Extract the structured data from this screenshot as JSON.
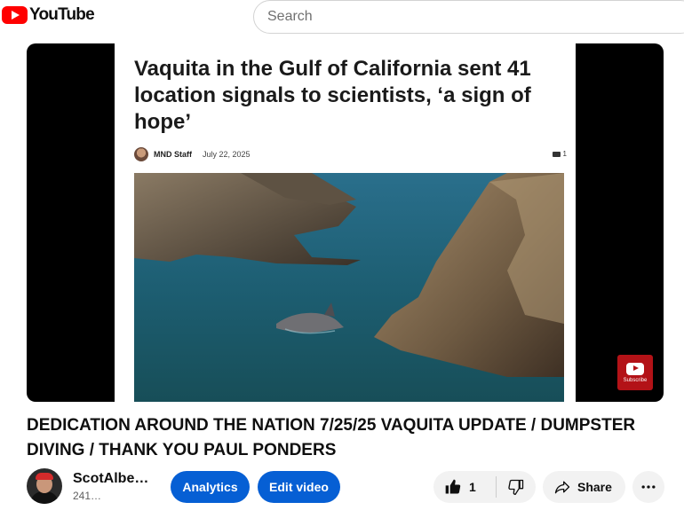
{
  "header": {
    "logo_text": "YouTube",
    "search_placeholder": "Search"
  },
  "player": {
    "article": {
      "headline": "Vaquita in the Gulf of California sent 41 location signals to scientists, ‘a sign of hope’",
      "author": "MND Staff",
      "date": "July 22, 2025",
      "comment_count": "1"
    },
    "subscribe_watermark": "Subscribe"
  },
  "video": {
    "title": "DEDICATION AROUND THE NATION 7/25/25 VAQUITA UPDATE / DUMPSTER DIVING / THANK YOU PAUL PONDERS"
  },
  "channel": {
    "name": "ScotAlber…",
    "subscribers": "241…"
  },
  "actions": {
    "analytics_label": "Analytics",
    "edit_label": "Edit video",
    "like_count": "1",
    "share_label": "Share"
  },
  "colors": {
    "brand": "#ff0000",
    "primary_button": "#065fd4"
  },
  "icons": [
    "youtube-logo-icon",
    "comment-icon",
    "subscribe-icon",
    "like-icon",
    "dislike-icon",
    "share-icon",
    "more-icon"
  ]
}
